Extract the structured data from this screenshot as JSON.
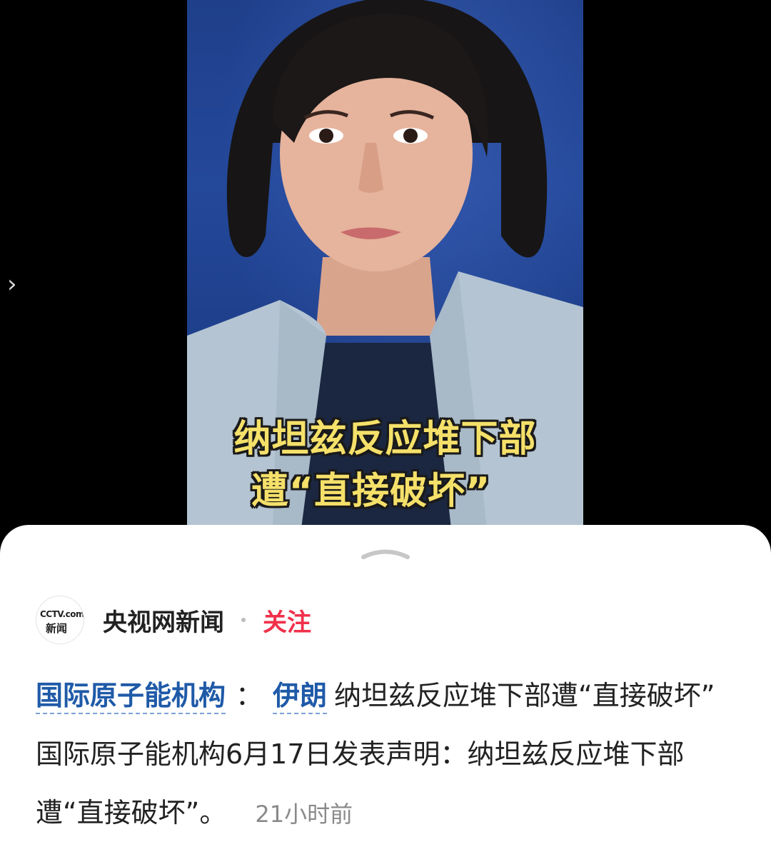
{
  "video": {
    "caption_line1": "纳坦兹反应堆下部",
    "caption_line2": "遭“直接破坏”"
  },
  "side_nav": {
    "icon": "chevron-right-icon"
  },
  "sheet": {
    "handle_icon": "chevron-up-icon",
    "author": {
      "avatar_line1": "CCTV.com",
      "avatar_line2": "新闻",
      "name": "央视网新闻",
      "follow_label": "关注"
    },
    "post": {
      "tag1": "国际原子能机构",
      "separator": "：",
      "tag2": "伊朗",
      "body": "纳坦兹反应堆下部遭“直接破坏” 国际原子能机构6月17日发表声明：纳坦兹反应堆下部遭“直接破坏”。",
      "time": "21小时前"
    }
  },
  "colors": {
    "follow": "#f0304a",
    "tag": "#1f5aa8",
    "caption": "#f5e06a"
  }
}
